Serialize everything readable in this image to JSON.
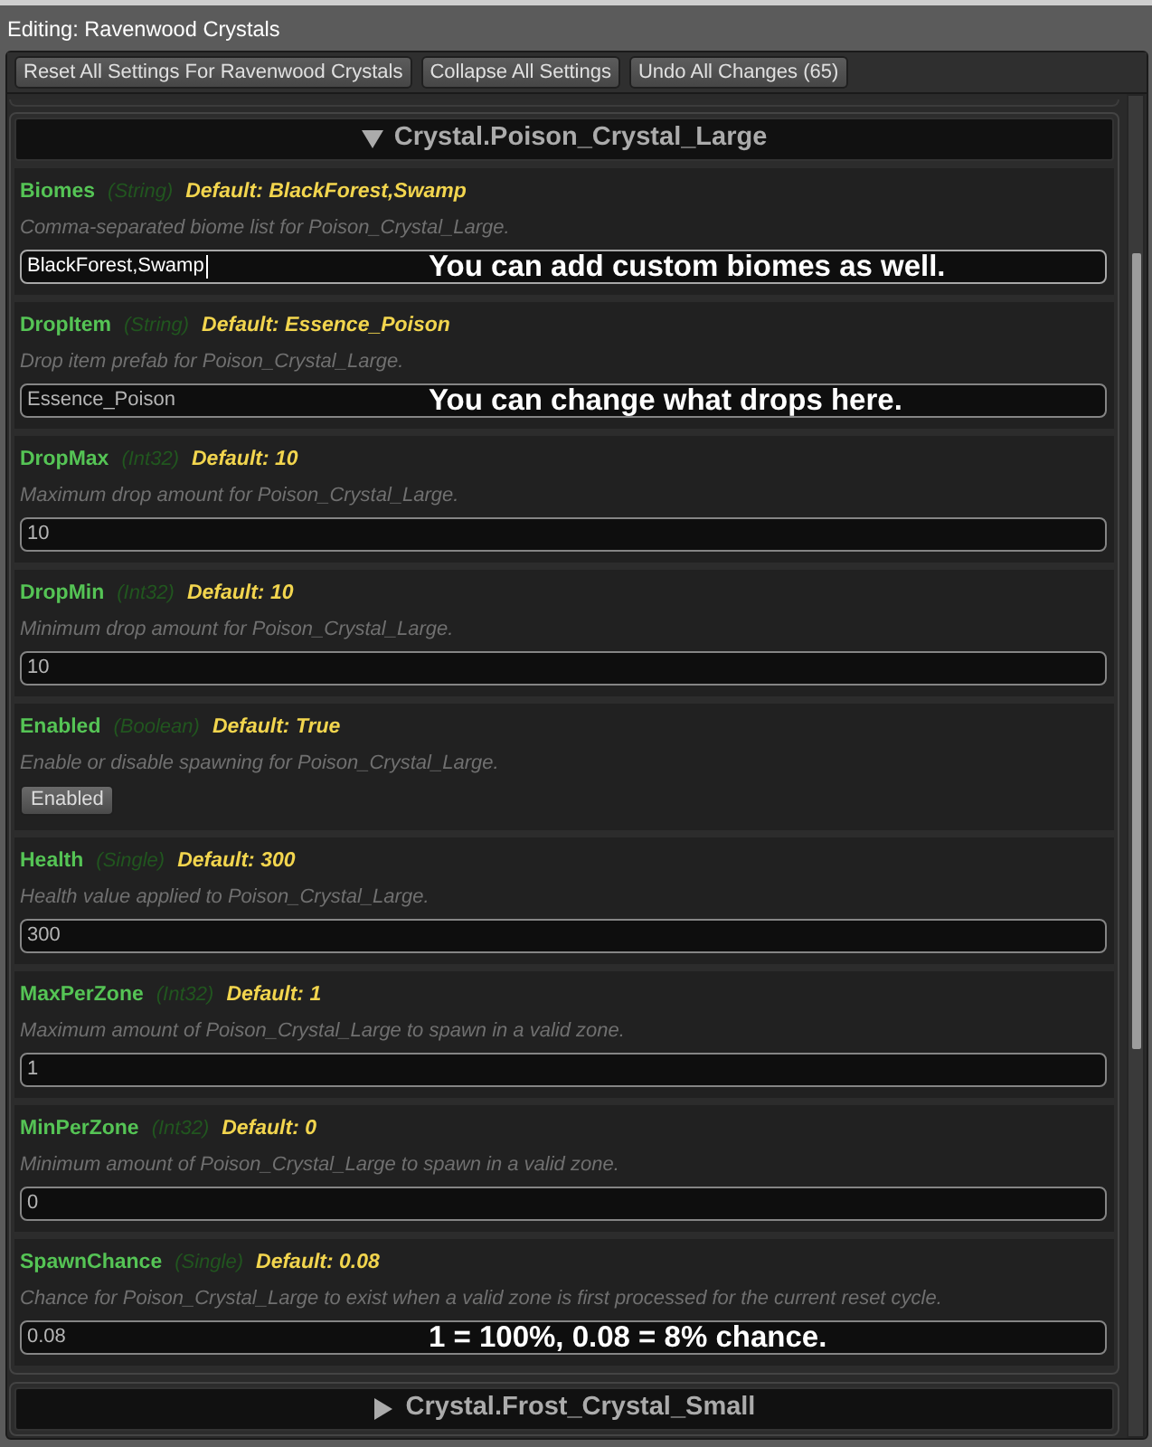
{
  "window": {
    "title": "Editing: Ravenwood Crystals"
  },
  "toolbar": {
    "buttons": [
      "Reset All Settings For Ravenwood Crystals",
      "Collapse All Settings",
      "Undo All Changes (65)"
    ]
  },
  "sections": [
    {
      "title": "Crystal.Poison_Crystal_Large",
      "expanded": true,
      "settings": [
        {
          "kind": "text",
          "name": "Biomes",
          "type": "(String)",
          "default": "Default: BlackForest,Swamp",
          "description": "Comma-separated biome list for Poison_Crystal_Large.",
          "value": "BlackForest,Swamp",
          "focused": true,
          "annotation": "You can add custom biomes as well."
        },
        {
          "kind": "text",
          "name": "DropItem",
          "type": "(String)",
          "default": "Default: Essence_Poison",
          "description": "Drop item prefab for Poison_Crystal_Large.",
          "value": "Essence_Poison",
          "focused": false,
          "annotation": "You can change what drops here."
        },
        {
          "kind": "text",
          "name": "DropMax",
          "type": "(Int32)",
          "default": "Default: 10",
          "description": "Maximum drop amount for Poison_Crystal_Large.",
          "value": "10",
          "focused": false
        },
        {
          "kind": "text",
          "name": "DropMin",
          "type": "(Int32)",
          "default": "Default: 10",
          "description": "Minimum drop amount for Poison_Crystal_Large.",
          "value": "10",
          "focused": false
        },
        {
          "kind": "toggle",
          "name": "Enabled",
          "type": "(Boolean)",
          "default": "Default: True",
          "description": "Enable or disable spawning for Poison_Crystal_Large.",
          "value": "Enabled"
        },
        {
          "kind": "text",
          "name": "Health",
          "type": "(Single)",
          "default": "Default: 300",
          "description": "Health value applied to Poison_Crystal_Large.",
          "value": "300",
          "focused": false
        },
        {
          "kind": "text",
          "name": "MaxPerZone",
          "type": "(Int32)",
          "default": "Default: 1",
          "description": "Maximum amount of Poison_Crystal_Large to spawn in a valid zone.",
          "value": "1",
          "focused": false
        },
        {
          "kind": "text",
          "name": "MinPerZone",
          "type": "(Int32)",
          "default": "Default: 0",
          "description": "Minimum amount of Poison_Crystal_Large to spawn in a valid zone.",
          "value": "0",
          "focused": false
        },
        {
          "kind": "text",
          "name": "SpawnChance",
          "type": "(Single)",
          "default": "Default: 0.08",
          "description": "Chance for Poison_Crystal_Large to exist when a valid zone is first processed for the current reset cycle.",
          "value": "0.08",
          "focused": false,
          "annotation": "1 = 100%, 0.08 = 8% chance."
        }
      ]
    },
    {
      "title": "Crystal.Frost_Crystal_Small",
      "expanded": false
    }
  ]
}
